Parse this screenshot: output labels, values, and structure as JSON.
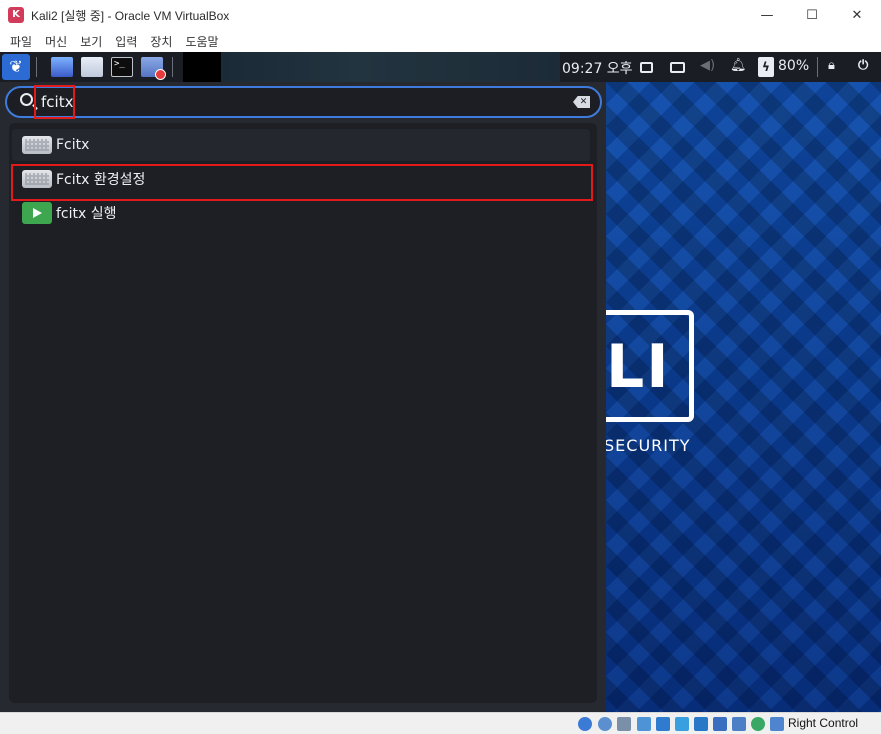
{
  "window": {
    "title": "Kali2 [실행 중] - Oracle VM VirtualBox",
    "minimize": "—",
    "maximize": "☐",
    "close": "✕"
  },
  "menubar": [
    "파일",
    "머신",
    "보기",
    "입력",
    "장치",
    "도움말"
  ],
  "panel": {
    "clock": "09:27 오후",
    "battery_percent": "80%",
    "kali_menu_icon": "kali-dragon-icon"
  },
  "search": {
    "value": "fcitx",
    "placeholder": ""
  },
  "results": [
    {
      "label": "Fcitx",
      "icon": "keyboard-icon"
    },
    {
      "label": "Fcitx 환경설정",
      "icon": "keyboard-icon"
    },
    {
      "label": "fcitx 실행",
      "icon": "play-icon"
    }
  ],
  "wallpaper": {
    "logo_letters": "LI",
    "logo_text": "SECURITY"
  },
  "statusbar": {
    "host_key": "Right Control"
  },
  "colors": {
    "accent": "#3f7bdd",
    "highlight": "#e31a1a",
    "menu_bg": "#262930"
  }
}
